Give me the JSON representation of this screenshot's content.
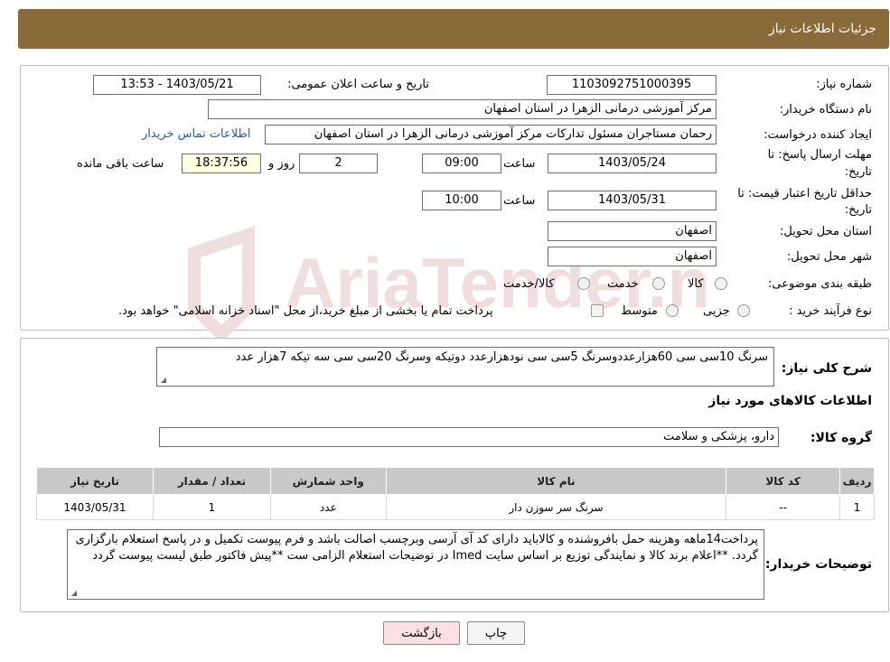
{
  "header": {
    "title": "جزئیات اطلاعات نیاز"
  },
  "fields": {
    "need_number_label": "شماره نیاز:",
    "need_number": "1103092751000395",
    "announce_label": "تاریخ و ساعت اعلان عمومی:",
    "announce_value": "1403/05/21 - 13:53",
    "buyer_org_label": "نام دستگاه خریدار:",
    "buyer_org": "مرکز آموزشی درمانی الزهرا در استان اصفهان",
    "creator_label": "ایجاد کننده درخواست:",
    "creator": "رحمان مستاجران مسئول تدارکات مرکز آموزشی درمانی الزهرا در استان اصفهان",
    "contact_link": "اطلاعات تماس خریدار",
    "deadline_label_1": "مهلت ارسال پاسخ: تا",
    "deadline_label_2": "تاریخ:",
    "deadline_date": "1403/05/24",
    "time_label": "ساعت",
    "deadline_time": "09:00",
    "days_value": "2",
    "days_label": "روز و",
    "remaining_time": "18:37:56",
    "remaining_label": "ساعت باقی مانده",
    "validity_label_1": "حداقل تاریخ اعتبار قیمت: تا",
    "validity_label_2": "تاریخ:",
    "validity_date": "1403/05/31",
    "validity_time_label": "ساعت",
    "validity_time": "10:00",
    "province_label": "استان محل تحویل:",
    "province": "اصفهان",
    "city_label": "شهر محل تحویل:",
    "city": "اصفهان",
    "category_label": "طبقه بندی موضوعی:",
    "category_options": [
      "کالا",
      "خدمت",
      "کالا/خدمت"
    ],
    "process_label": "نوع فرآیند خرید :",
    "process_options": [
      "جزیی",
      "متوسط"
    ],
    "process_note": "پرداخت تمام یا بخشی از مبلغ خرید،از محل \"اسناد خزانه اسلامی\" خواهد بود."
  },
  "details": {
    "summary_label": "شرح کلی نیاز:",
    "summary": "سرنگ 10سی سی 60هزارعددوسرنگ 5سی سی نودهزارعدد دوتیکه وسرنگ 20سی سی سه تیکه 7هزار عدد",
    "goods_info_title": "اطلاعات کالاهای مورد نیاز",
    "goods_group_label": "گروه کالا:",
    "goods_group": "دارو، پزشکی و سلامت",
    "table": {
      "headers": [
        "ردیف",
        "کد کالا",
        "نام کالا",
        "واحد شمارش",
        "تعداد / مقدار",
        "تاریخ نیاز"
      ],
      "rows": [
        [
          "1",
          "--",
          "سرنگ سر سوزن دار",
          "عدد",
          "1",
          "1403/05/31"
        ]
      ]
    },
    "buyer_notes_label": "توضیحات خریدار:",
    "buyer_notes": "پرداخت14ماهه وهزینه حمل بافروشنده و کالاباید دارای کد آی آرسی وبرچسب اصالت باشد و فرم پیوست تکمیل و در پاسخ استعلام بارگزاری گردد. **اعلام برند کالا و نمایندگی توزیع بر اساس سایت Imed در توضیحات استعلام الزامی ست **پیش فاکتور طبق لیست پیوست گردد"
  },
  "buttons": {
    "print": "چاپ",
    "back": "بازگشت"
  },
  "watermark": {
    "text": "AriaTender.neT"
  },
  "colors": {
    "header_bg": "#8b6a3a",
    "link": "#1a5fb4",
    "back_button_bg": "#fde0e4",
    "watermark": "#f0dede"
  }
}
